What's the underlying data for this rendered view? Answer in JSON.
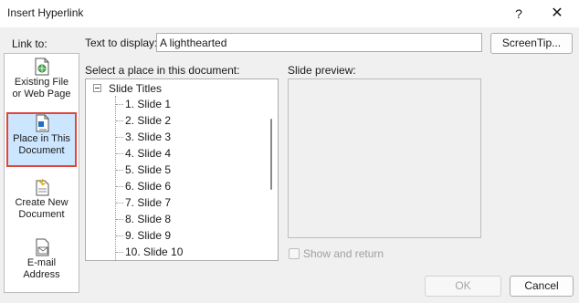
{
  "window": {
    "title": "Insert Hyperlink",
    "help_glyph": "?",
    "close_glyph": "✕"
  },
  "link_to": {
    "label": "Link to:",
    "items": [
      {
        "line1": "Existing File",
        "line2": "or Web Page",
        "icon": "web-page-icon",
        "selected": false
      },
      {
        "line1": "Place in This",
        "line2": "Document",
        "icon": "document-place-icon",
        "selected": true
      },
      {
        "line1": "Create New",
        "line2": "Document",
        "icon": "new-document-icon",
        "selected": false
      },
      {
        "line1": "E-mail",
        "line2": "Address",
        "icon": "email-icon",
        "selected": false
      }
    ]
  },
  "text_to_display": {
    "label": "Text to display:",
    "value": "A lighthearted"
  },
  "screentip_button": "ScreenTip...",
  "place_list": {
    "label": "Select a place in this document:",
    "root": "Slide Titles",
    "slides": [
      "1. Slide 1",
      "2. Slide 2",
      "3. Slide 3",
      "4. Slide 4",
      "5. Slide 5",
      "6. Slide 6",
      "7. Slide 7",
      "8. Slide 8",
      "9. Slide 9",
      "10. Slide 10"
    ]
  },
  "slide_preview": {
    "label": "Slide preview:"
  },
  "show_and_return": {
    "label": "Show and return",
    "checked": false,
    "enabled": false
  },
  "buttons": {
    "ok": "OK",
    "cancel": "Cancel"
  },
  "colors": {
    "selected_bg": "#cce6ff",
    "selected_border": "#e0463c",
    "dialog_bg": "#f0f0f0"
  }
}
